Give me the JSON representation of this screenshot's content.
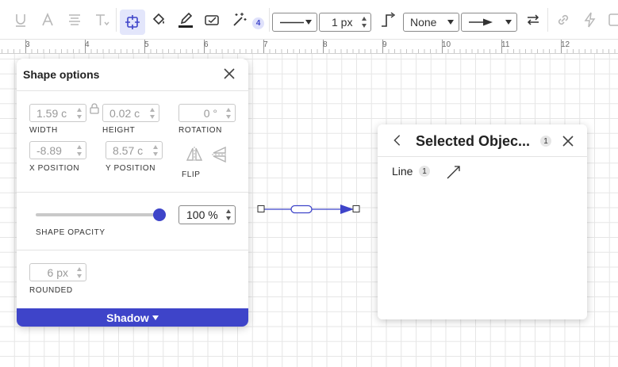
{
  "toolbar": {
    "ai_badge": "4",
    "line_width": "1 px",
    "start_arrow": "None",
    "colors": {
      "accent": "#3e44c9",
      "accent_bg": "#e3e6fb"
    }
  },
  "ruler": {
    "labels": [
      "3",
      "4",
      "5",
      "6",
      "7",
      "8",
      "9",
      "10",
      "11",
      "12"
    ]
  },
  "shape_panel": {
    "title": "Shape options",
    "width": {
      "value": "1.59 c",
      "label": "WIDTH"
    },
    "height": {
      "value": "0.02 c",
      "label": "HEIGHT"
    },
    "rotation": {
      "value": "0 °",
      "label": "ROTATION"
    },
    "x_position": {
      "value": "-8.89",
      "label": "X POSITION"
    },
    "y_position": {
      "value": "8.57 c",
      "label": "Y POSITION"
    },
    "flip_label": "FLIP",
    "opacity": {
      "value": "100 %",
      "label": "SHAPE OPACITY",
      "level": 1.0
    },
    "rounded": {
      "value": "6 px",
      "label": "ROUNDED"
    },
    "shadow_label": "Shadow"
  },
  "selected_panel": {
    "title": "Selected Objec...",
    "count": "1",
    "items": [
      {
        "label": "Line",
        "count": "1",
        "icon": "arrow-line-icon"
      }
    ]
  }
}
